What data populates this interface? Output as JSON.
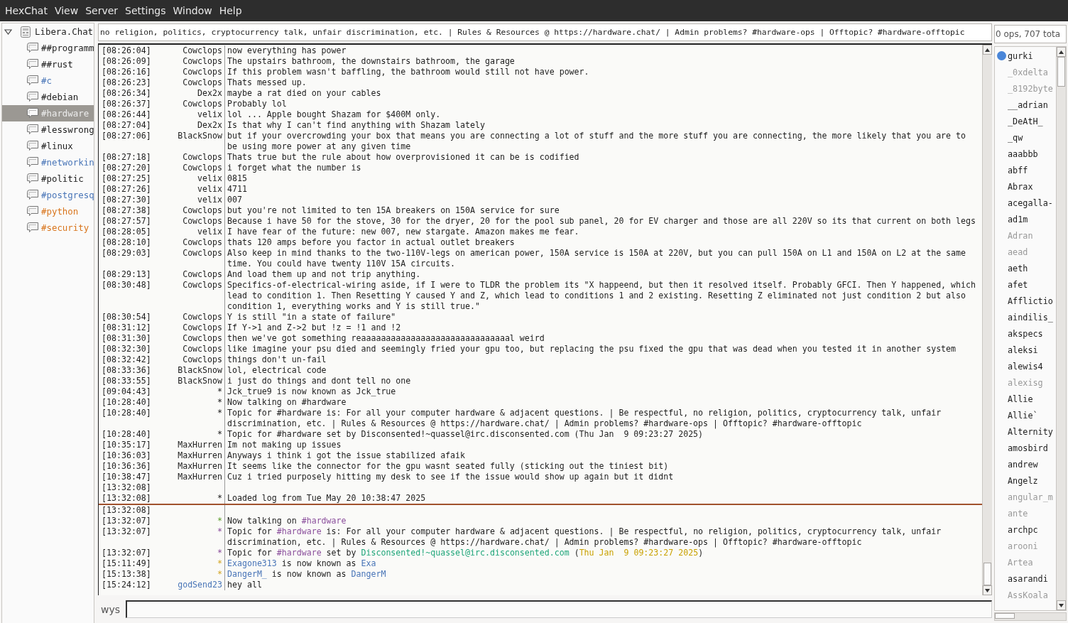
{
  "menu": [
    "HexChat",
    "View",
    "Server",
    "Settings",
    "Window",
    "Help"
  ],
  "channel_tree": {
    "server": "Libera.Chat",
    "expanded": true,
    "channels": [
      {
        "name": "##programm",
        "color": "#1e1e1e",
        "selected": false
      },
      {
        "name": "##rust",
        "color": "#1e1e1e",
        "selected": false
      },
      {
        "name": "#c",
        "color": "#4a76b8",
        "selected": false
      },
      {
        "name": "#debian",
        "color": "#1e1e1e",
        "selected": false
      },
      {
        "name": "#hardware",
        "color": "#ececec",
        "selected": true
      },
      {
        "name": "#lesswrong",
        "color": "#1e1e1e",
        "selected": false
      },
      {
        "name": "#linux",
        "color": "#1e1e1e",
        "selected": false
      },
      {
        "name": "#networkin",
        "color": "#4a76b8",
        "selected": false
      },
      {
        "name": "#politic",
        "color": "#1e1e1e",
        "selected": false
      },
      {
        "name": "#postgresq",
        "color": "#4a76b8",
        "selected": false
      },
      {
        "name": "#python",
        "color": "#d9761e",
        "selected": false
      },
      {
        "name": "#security",
        "color": "#d9761e",
        "selected": false
      }
    ]
  },
  "topic": "no religion, politics, cryptocurrency talk, unfair discrimination, etc. | Rules & Resources @ https://hardware.chat/ | Admin problems? #hardware-ops | Offtopic? #hardware-offtopic",
  "chat": {
    "history": [
      {
        "time": "[08:26:04]",
        "nick": "Cowclops",
        "text": "now everything has power"
      },
      {
        "time": "[08:26:09]",
        "nick": "Cowclops",
        "text": "The upstairs bathroom, the downstairs bathroom, the garage"
      },
      {
        "time": "[08:26:16]",
        "nick": "Cowclops",
        "text": "If this problem wasn't baffling, the bathroom would still not have power."
      },
      {
        "time": "[08:26:23]",
        "nick": "Cowclops",
        "text": "Thats messed up."
      },
      {
        "time": "[08:26:34]",
        "nick": "Dex2x",
        "text": "maybe a rat died on your cables"
      },
      {
        "time": "[08:26:37]",
        "nick": "Cowclops",
        "text": "Probably lol"
      },
      {
        "time": "[08:26:44]",
        "nick": "velix",
        "text": "lol ... Apple bought Shazam for $400M only."
      },
      {
        "time": "[08:27:04]",
        "nick": "Dex2x",
        "text": "Is that why I can't find anything with Shazam lately"
      },
      {
        "time": "[08:27:06]",
        "nick": "BlackSnow",
        "text": "but if your overcrowding your box that means you are connecting a lot of stuff and the more stuff you are connecting, the more likely that you are to be using more power at any given time"
      },
      {
        "time": "[08:27:18]",
        "nick": "Cowclops",
        "text": "Thats true but the rule about how overprovisioned it can be is codified"
      },
      {
        "time": "[08:27:20]",
        "nick": "Cowclops",
        "text": "i forget what the number is"
      },
      {
        "time": "[08:27:25]",
        "nick": "velix",
        "text": "0815"
      },
      {
        "time": "[08:27:26]",
        "nick": "velix",
        "text": "4711"
      },
      {
        "time": "[08:27:30]",
        "nick": "velix",
        "text": "007"
      },
      {
        "time": "[08:27:38]",
        "nick": "Cowclops",
        "text": "but you're not limited to ten 15A breakers on 150A service for sure"
      },
      {
        "time": "[08:27:57]",
        "nick": "Cowclops",
        "text": "Because i have 50 for the stove, 30 for the dryer, 20 for the pool sub panel, 20 for EV charger and those are all 220V so its that current on both legs"
      },
      {
        "time": "[08:28:05]",
        "nick": "velix",
        "text": "I have fear of the future: new 007, new stargate. Amazon makes me fear."
      },
      {
        "time": "[08:28:10]",
        "nick": "Cowclops",
        "text": "thats 120 amps before you factor in actual outlet breakers"
      },
      {
        "time": "[08:29:03]",
        "nick": "Cowclops",
        "text": "Also keep in mind thanks to the two-110V-legs on american power, 150A service is 150A at 220V, but you can pull 150A on L1 and 150A on L2 at the same time. You could have twenty 110V 15A circuits."
      },
      {
        "time": "[08:29:13]",
        "nick": "Cowclops",
        "text": "And load them up and not trip anything."
      },
      {
        "time": "[08:30:48]",
        "nick": "Cowclops",
        "text": "Specifics-of-electrical-wiring aside, if I were to TLDR the problem its \"X happeend, but then it resolved itself. Probably GFCI. Then Y happened, which lead to condition 1. Then Resetting Y caused Y and Z, which lead to conditions 1 and 2 existing. Resetting Z eliminated not just condition 2 but also condition 1, everything works and Y is still true.\""
      },
      {
        "time": "[08:30:54]",
        "nick": "Cowclops",
        "text": "Y is still \"in a state of failure\""
      },
      {
        "time": "[08:31:12]",
        "nick": "Cowclops",
        "text": "If Y->1 and Z->2 but !z = !1 and !2"
      },
      {
        "time": "[08:31:30]",
        "nick": "Cowclops",
        "text": "then we've got something reaaaaaaaaaaaaaaaaaaaaaaaaaaaaaal weird"
      },
      {
        "time": "[08:32:30]",
        "nick": "Cowclops",
        "text": "like imagine your psu died and seemingly fried your gpu too, but replacing the psu fixed the gpu that was dead when you tested it in another system"
      },
      {
        "time": "[08:32:42]",
        "nick": "Cowclops",
        "text": "things don't un-fail"
      },
      {
        "time": "[08:33:36]",
        "nick": "BlackSnow",
        "text": "lol, electrical code"
      },
      {
        "time": "[08:33:55]",
        "nick": "BlackSnow",
        "text": "i just do things and dont tell no one"
      },
      {
        "time": "[09:04:43]",
        "nick": "*",
        "text": "Jck_true9 is now known as Jck_true"
      },
      {
        "time": "[10:28:40]",
        "nick": "*",
        "text": "Now talking on #hardware"
      },
      {
        "time": "[10:28:40]",
        "nick": "*",
        "text": "Topic for #hardware is: For all your computer hardware & adjacent questions. | Be respectful, no religion, politics, cryptocurrency talk, unfair discrimination, etc. | Rules & Resources @ https://hardware.chat/ | Admin problems? #hardware-ops | Offtopic? #hardware-offtopic"
      },
      {
        "time": "[10:28:40]",
        "nick": "*",
        "text": "Topic for #hardware set by Disconsented!~quassel@irc.disconsented.com (Thu Jan  9 09:23:27 2025)"
      },
      {
        "time": "[10:35:17]",
        "nick": "MaxHurren",
        "text": "Im not making up issues"
      },
      {
        "time": "[10:36:03]",
        "nick": "MaxHurren",
        "text": "Anyways i think i got the issue stabilized afaik"
      },
      {
        "time": "[10:36:36]",
        "nick": "MaxHurren",
        "text": "It seems like the connector for the gpu wasnt seated fully (sticking out the tiniest bit)"
      },
      {
        "time": "[10:38:47]",
        "nick": "MaxHurren",
        "text": "Cuz i tried purposely hitting my desk to see if the issue would show up again but it didnt"
      },
      {
        "time": "[13:32:08]"
      },
      {
        "time": "[13:32:08]",
        "nick": "*",
        "text": "Loaded log from Tue May 20 10:38:47 2025"
      }
    ],
    "recent": [
      {
        "time": "[13:32:08]"
      },
      {
        "time": "[13:32:07]",
        "nick": "*",
        "kind": "talking",
        "segments": [
          {
            "text": "Now talking on "
          },
          {
            "text": "#hardware",
            "color": "#8b4f9c"
          }
        ]
      },
      {
        "time": "[13:32:07]",
        "nick": "*",
        "kind": "topic",
        "segments": [
          {
            "text": "Topic for "
          },
          {
            "text": "#hardware",
            "color": "#8b4f9c"
          },
          {
            "text": " is: For all your computer hardware & adjacent questions. | Be respectful, no religion, politics, cryptocurrency talk, unfair discrimination, etc. | Rules & Resources @ https://hardware.chat/ | Admin problems? #hardware-ops | Offtopic? #hardware-offtopic"
          }
        ]
      },
      {
        "time": "[13:32:07]",
        "nick": "*",
        "kind": "topic",
        "segments": [
          {
            "text": "Topic for "
          },
          {
            "text": "#hardware",
            "color": "#8b4f9c"
          },
          {
            "text": " set by "
          },
          {
            "text": "Disconsented!~quassel@irc.disconsented.com",
            "color": "#1fa67a"
          },
          {
            "text": " ("
          },
          {
            "text": "Thu Jan  9 09:23:27 2025",
            "color": "#c9a100"
          },
          {
            "text": ")"
          }
        ]
      },
      {
        "time": "[15:11:49]",
        "nick": "*",
        "kind": "rename",
        "segments": [
          {
            "text": "Exagone313",
            "color": "#4a76b8"
          },
          {
            "text": " is now known as "
          },
          {
            "text": "Exa",
            "color": "#4a76b8"
          }
        ]
      },
      {
        "time": "[15:13:38]",
        "nick": "*",
        "kind": "rename",
        "segments": [
          {
            "text": "DangerM_",
            "color": "#4a76b8"
          },
          {
            "text": " is now known as "
          },
          {
            "text": "DangerM",
            "color": "#4a76b8"
          }
        ]
      },
      {
        "time": "[15:24:12]",
        "nick": "godSend23",
        "color": "#4a76b8",
        "text": "hey all"
      }
    ]
  },
  "input": {
    "nick": "wys"
  },
  "users": {
    "count": "0 ops, 707 tota",
    "list": [
      {
        "name": "gurki",
        "away": false,
        "badge": {
          "color": "#4a86d8"
        }
      },
      {
        "name": "_0xdelta",
        "away": true
      },
      {
        "name": "_8192byte",
        "away": true
      },
      {
        "name": "__adrian",
        "away": false
      },
      {
        "name": "_DeAtH_",
        "away": false
      },
      {
        "name": "_qw",
        "away": false
      },
      {
        "name": "aaabbb",
        "away": false
      },
      {
        "name": "abff",
        "away": false
      },
      {
        "name": "Abrax",
        "away": false
      },
      {
        "name": "acegalla-",
        "away": false
      },
      {
        "name": "ad1m",
        "away": false
      },
      {
        "name": "Adran",
        "away": true
      },
      {
        "name": "aead",
        "away": true
      },
      {
        "name": "aeth",
        "away": false
      },
      {
        "name": "afet",
        "away": false
      },
      {
        "name": "Afflictio",
        "away": false
      },
      {
        "name": "aindilis_",
        "away": false
      },
      {
        "name": "akspecs",
        "away": false
      },
      {
        "name": "aleksi",
        "away": false
      },
      {
        "name": "alewis4",
        "away": false
      },
      {
        "name": "alexisg",
        "away": true
      },
      {
        "name": "Allie",
        "away": false
      },
      {
        "name": "Allie`",
        "away": false
      },
      {
        "name": "Alternity",
        "away": false
      },
      {
        "name": "amosbird",
        "away": false
      },
      {
        "name": "andrew",
        "away": false
      },
      {
        "name": "Angelz",
        "away": false
      },
      {
        "name": "angular_m",
        "away": true
      },
      {
        "name": "ante",
        "away": true
      },
      {
        "name": "archpc",
        "away": false
      },
      {
        "name": "arooni",
        "away": true
      },
      {
        "name": "Artea",
        "away": true
      },
      {
        "name": "asarandi",
        "away": false
      },
      {
        "name": "AssKoala",
        "away": true
      }
    ]
  }
}
